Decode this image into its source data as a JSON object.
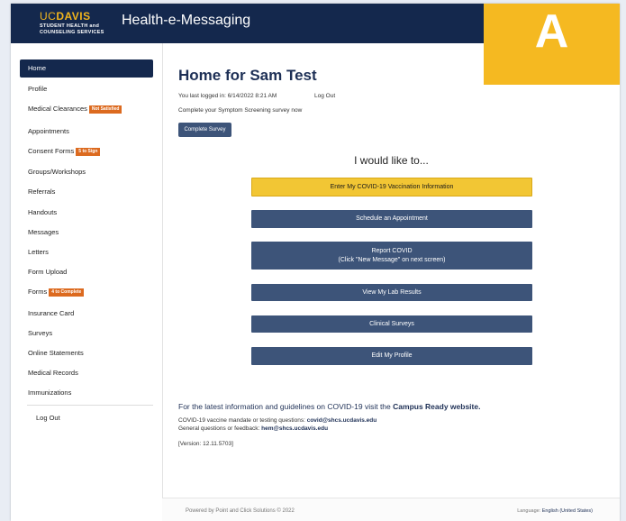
{
  "header": {
    "logo_uc": "UC",
    "logo_davis": "DAVIS",
    "logo_line1": "STUDENT HEALTH and",
    "logo_line2": "COUNSELING SERVICES",
    "title": "Health-e-Messaging",
    "badge_letter": "A"
  },
  "sidebar": {
    "items": [
      {
        "label": "Home"
      },
      {
        "label": "Profile"
      },
      {
        "label": "Medical Clearances",
        "badge": "Not Satisfied"
      },
      {
        "label": "Appointments"
      },
      {
        "label": "Consent Forms",
        "badge": "5 to Sign"
      },
      {
        "label": "Groups/Workshops"
      },
      {
        "label": "Referrals"
      },
      {
        "label": "Handouts"
      },
      {
        "label": "Messages"
      },
      {
        "label": "Letters"
      },
      {
        "label": "Form Upload"
      },
      {
        "label": "Forms",
        "badge": "4 to Complete"
      },
      {
        "label": "Insurance Card"
      },
      {
        "label": "Surveys"
      },
      {
        "label": "Online Statements"
      },
      {
        "label": "Medical Records"
      },
      {
        "label": "Immunizations"
      }
    ],
    "logout": "Log Out"
  },
  "main": {
    "title": "Home for Sam Test",
    "last_login": "You last logged in: 6/14/2022 8:21 AM",
    "logout_link": "Log Out",
    "survey_message": "Complete your Symptom Screening survey now",
    "complete_survey_button": "Complete Survey",
    "would_like": "I would like to...",
    "actions": [
      {
        "label": "Enter My COVID-19 Vaccination Information"
      },
      {
        "label": "Schedule an Appointment"
      },
      {
        "label": "Report COVID",
        "sub": "(Click \"New Message\" on next screen)"
      },
      {
        "label": "View My Lab Results"
      },
      {
        "label": "Clinical Surveys"
      },
      {
        "label": "Edit My Profile"
      }
    ],
    "covid_info_text": "For the latest information and guidelines on COVID-19 visit the",
    "covid_info_link": "Campus Ready website.",
    "mandate_label": "COVID-19 vaccine mandate or testing questions:",
    "mandate_email": "covid@shcs.ucdavis.edu",
    "general_label": "General questions or feedback:",
    "general_email": "hem@shcs.ucdavis.edu",
    "version": "[Version: 12.11.5703]"
  },
  "footer": {
    "powered_by": "Powered by Point and Click Solutions © 2022",
    "language_label": "Language:",
    "language_value": "English (United States)"
  },
  "colors": {
    "navy": "#14284d",
    "button_blue": "#3d5479",
    "gold": "#f5b921",
    "badge_orange": "#dc6a1f",
    "highlight_yellow": "#f2c634"
  }
}
